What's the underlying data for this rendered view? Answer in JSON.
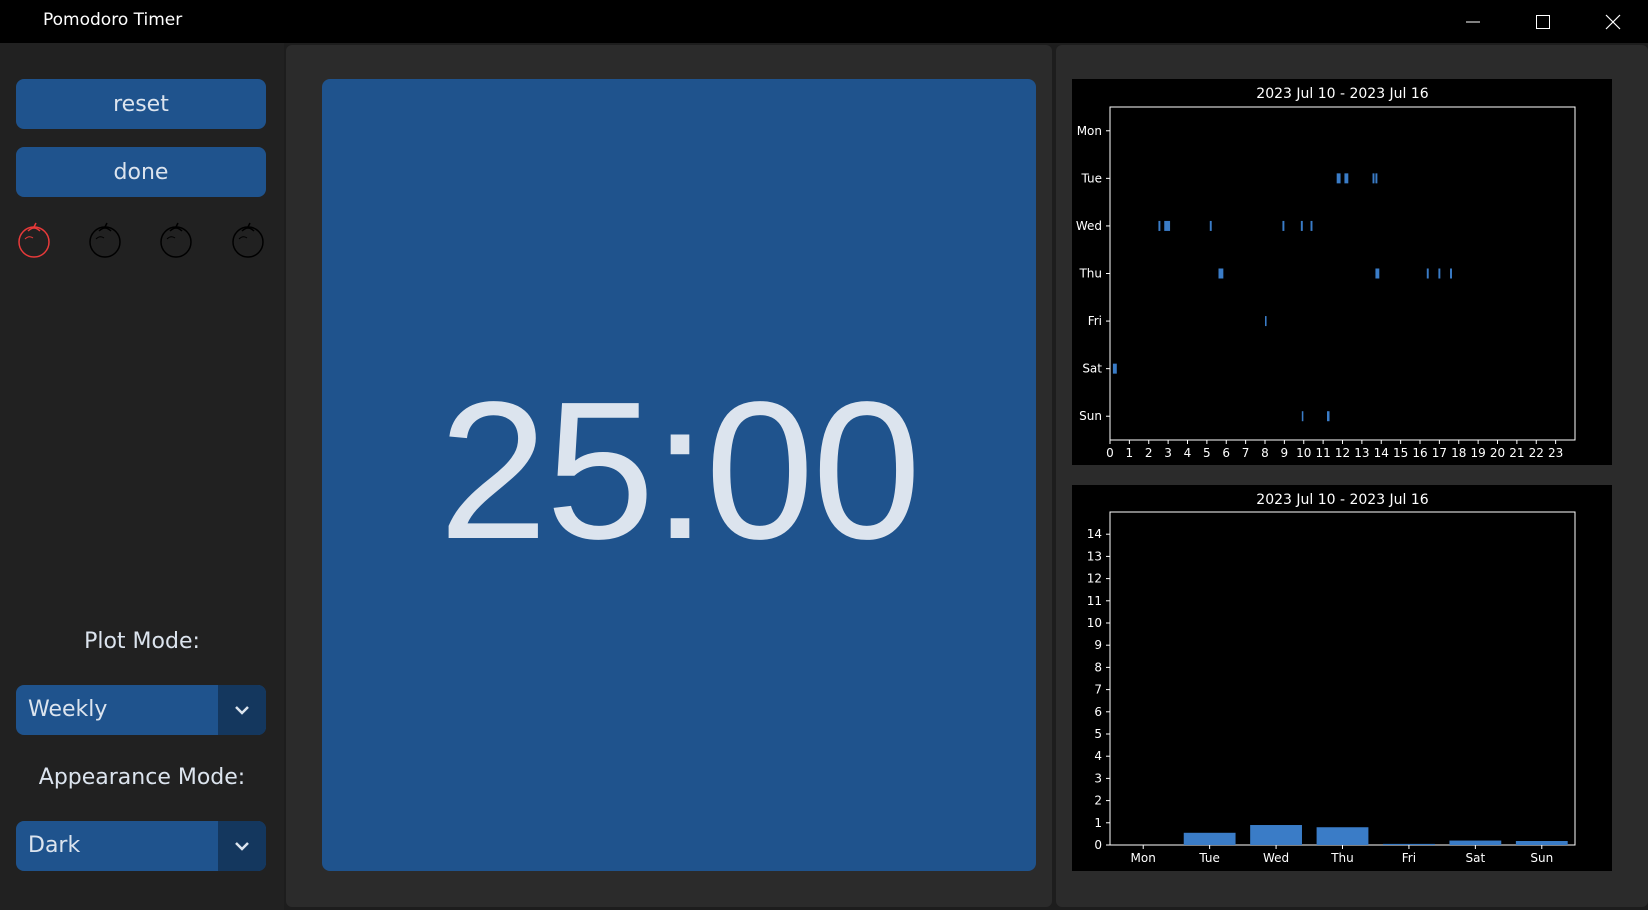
{
  "window": {
    "title": "Pomodoro Timer",
    "minimize_icon": "minimize-icon",
    "maximize_icon": "maximize-icon",
    "close_icon": "close-icon"
  },
  "sidebar": {
    "reset_label": "reset",
    "done_label": "done",
    "tomatoes": [
      {
        "icon": "tomato-icon",
        "state": "active",
        "color": "#e83a3a"
      },
      {
        "icon": "tomato-icon",
        "state": "inactive",
        "color": "#000000"
      },
      {
        "icon": "tomato-icon",
        "state": "inactive",
        "color": "#000000"
      },
      {
        "icon": "tomato-icon",
        "state": "inactive",
        "color": "#000000"
      }
    ],
    "plot_mode_label": "Plot Mode:",
    "plot_mode_value": "Weekly",
    "appearance_mode_label": "Appearance Mode:",
    "appearance_mode_value": "Dark"
  },
  "timer": {
    "display": "25:00"
  },
  "colors": {
    "accent": "#1f538d",
    "accent_dark": "#14375e",
    "bar": "#3a7cc7",
    "text": "#dce4ee"
  },
  "chart_data": [
    {
      "type": "scatter",
      "title": "2023 Jul 10 - 2023 Jul 16",
      "xlabel": "",
      "ylabel": "",
      "xlim": [
        0,
        24
      ],
      "x_ticks": [
        "0",
        "1",
        "2",
        "3",
        "4",
        "5",
        "6",
        "7",
        "8",
        "9",
        "10",
        "11",
        "12",
        "13",
        "14",
        "15",
        "16",
        "17",
        "18",
        "19",
        "20",
        "21",
        "22",
        "23"
      ],
      "y_categories": [
        "Mon",
        "Tue",
        "Wed",
        "Thu",
        "Fri",
        "Sat",
        "Sun"
      ],
      "grid": false,
      "sessions": [
        {
          "day": "Tue",
          "start": 11.7,
          "end": 11.9
        },
        {
          "day": "Tue",
          "start": 12.1,
          "end": 12.3
        },
        {
          "day": "Tue",
          "start": 13.55,
          "end": 13.65
        },
        {
          "day": "Tue",
          "start": 13.7,
          "end": 13.8
        },
        {
          "day": "Wed",
          "start": 2.5,
          "end": 2.6
        },
        {
          "day": "Wed",
          "start": 2.8,
          "end": 3.1
        },
        {
          "day": "Wed",
          "start": 5.15,
          "end": 5.25
        },
        {
          "day": "Wed",
          "start": 8.9,
          "end": 9.0
        },
        {
          "day": "Wed",
          "start": 9.85,
          "end": 9.95
        },
        {
          "day": "Wed",
          "start": 10.35,
          "end": 10.45
        },
        {
          "day": "Thu",
          "start": 5.6,
          "end": 5.85
        },
        {
          "day": "Thu",
          "start": 13.7,
          "end": 13.9
        },
        {
          "day": "Thu",
          "start": 16.35,
          "end": 16.45
        },
        {
          "day": "Thu",
          "start": 16.95,
          "end": 17.05
        },
        {
          "day": "Thu",
          "start": 17.55,
          "end": 17.65
        },
        {
          "day": "Fri",
          "start": 8.0,
          "end": 8.08
        },
        {
          "day": "Sat",
          "start": 0.15,
          "end": 0.35
        },
        {
          "day": "Sun",
          "start": 9.9,
          "end": 9.98
        },
        {
          "day": "Sun",
          "start": 11.2,
          "end": 11.33
        }
      ]
    },
    {
      "type": "bar",
      "title": "2023 Jul 10 - 2023 Jul 16",
      "xlabel": "",
      "ylabel": "",
      "categories": [
        "Mon",
        "Tue",
        "Wed",
        "Thu",
        "Fri",
        "Sat",
        "Sun"
      ],
      "values": [
        0,
        0.55,
        0.9,
        0.8,
        0.05,
        0.2,
        0.18
      ],
      "ylim": [
        0,
        15
      ],
      "y_ticks": [
        "0",
        "1",
        "2",
        "3",
        "4",
        "5",
        "6",
        "7",
        "8",
        "9",
        "10",
        "11",
        "12",
        "13",
        "14"
      ],
      "grid": false
    }
  ]
}
